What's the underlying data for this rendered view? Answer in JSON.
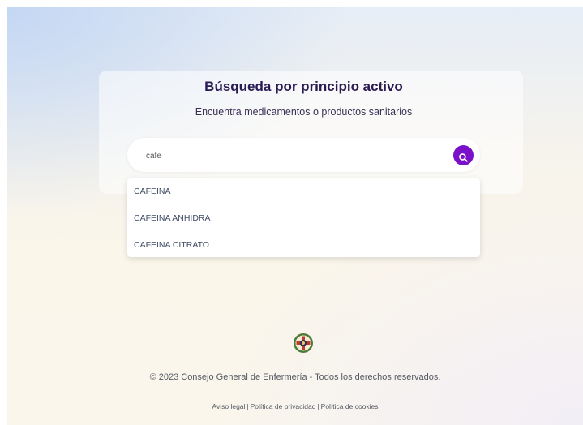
{
  "header": {
    "title": "Búsqueda por principio activo",
    "subtitle": "Encuentra medicamentos o productos sanitarios"
  },
  "search": {
    "value": "cafe",
    "button_icon": "search-icon"
  },
  "suggestions": [
    "CAFEINA",
    "CAFEINA ANHIDRA",
    "CAFEINA CITRATO"
  ],
  "footer": {
    "logo_icon": "organization-emblem-icon",
    "copyright": "© 2023 Consejo General de Enfermería - Todos los derechos reservados.",
    "links": [
      "Aviso legal",
      "Política de privacidad",
      "Política de cookies"
    ],
    "separator": "|"
  },
  "colors": {
    "accent": "#7b10c9",
    "title": "#2a1a52",
    "option_text": "#3f4d66"
  }
}
